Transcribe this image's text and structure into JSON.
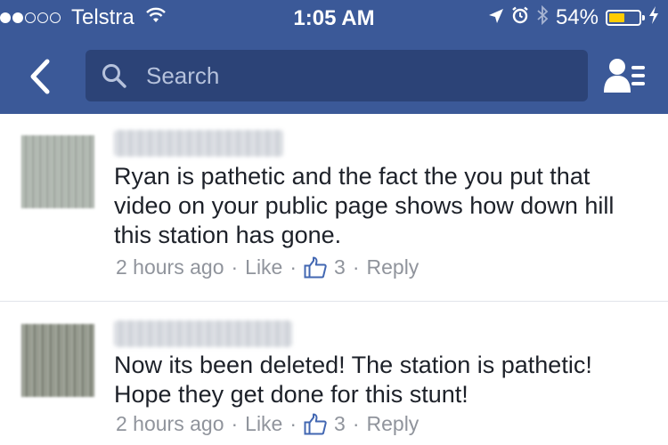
{
  "status_bar": {
    "carrier": "Telstra",
    "signal_dots_on": 2,
    "signal_dots_total": 5,
    "time": "1:05 AM",
    "battery_percent": "54%",
    "battery_level": 0.54
  },
  "nav": {
    "search_placeholder": "Search"
  },
  "comments": [
    {
      "text": "Ryan is pathetic and the fact the you put that video on your public page shows how down hill this station has gone.",
      "time": "2 hours ago",
      "like_label": "Like",
      "like_count": "3",
      "reply_label": "Reply"
    },
    {
      "text": "Now its been deleted! The station is pathetic! Hope they get done for this stunt!",
      "time": "2 hours ago",
      "like_label": "Like",
      "like_count": "3",
      "reply_label": "Reply"
    }
  ],
  "colors": {
    "header_bg": "#3b5998",
    "search_bg": "#2c4377",
    "battery": "#ffcc00",
    "meta_text": "#90949c",
    "like_icon": "#4267b2"
  }
}
